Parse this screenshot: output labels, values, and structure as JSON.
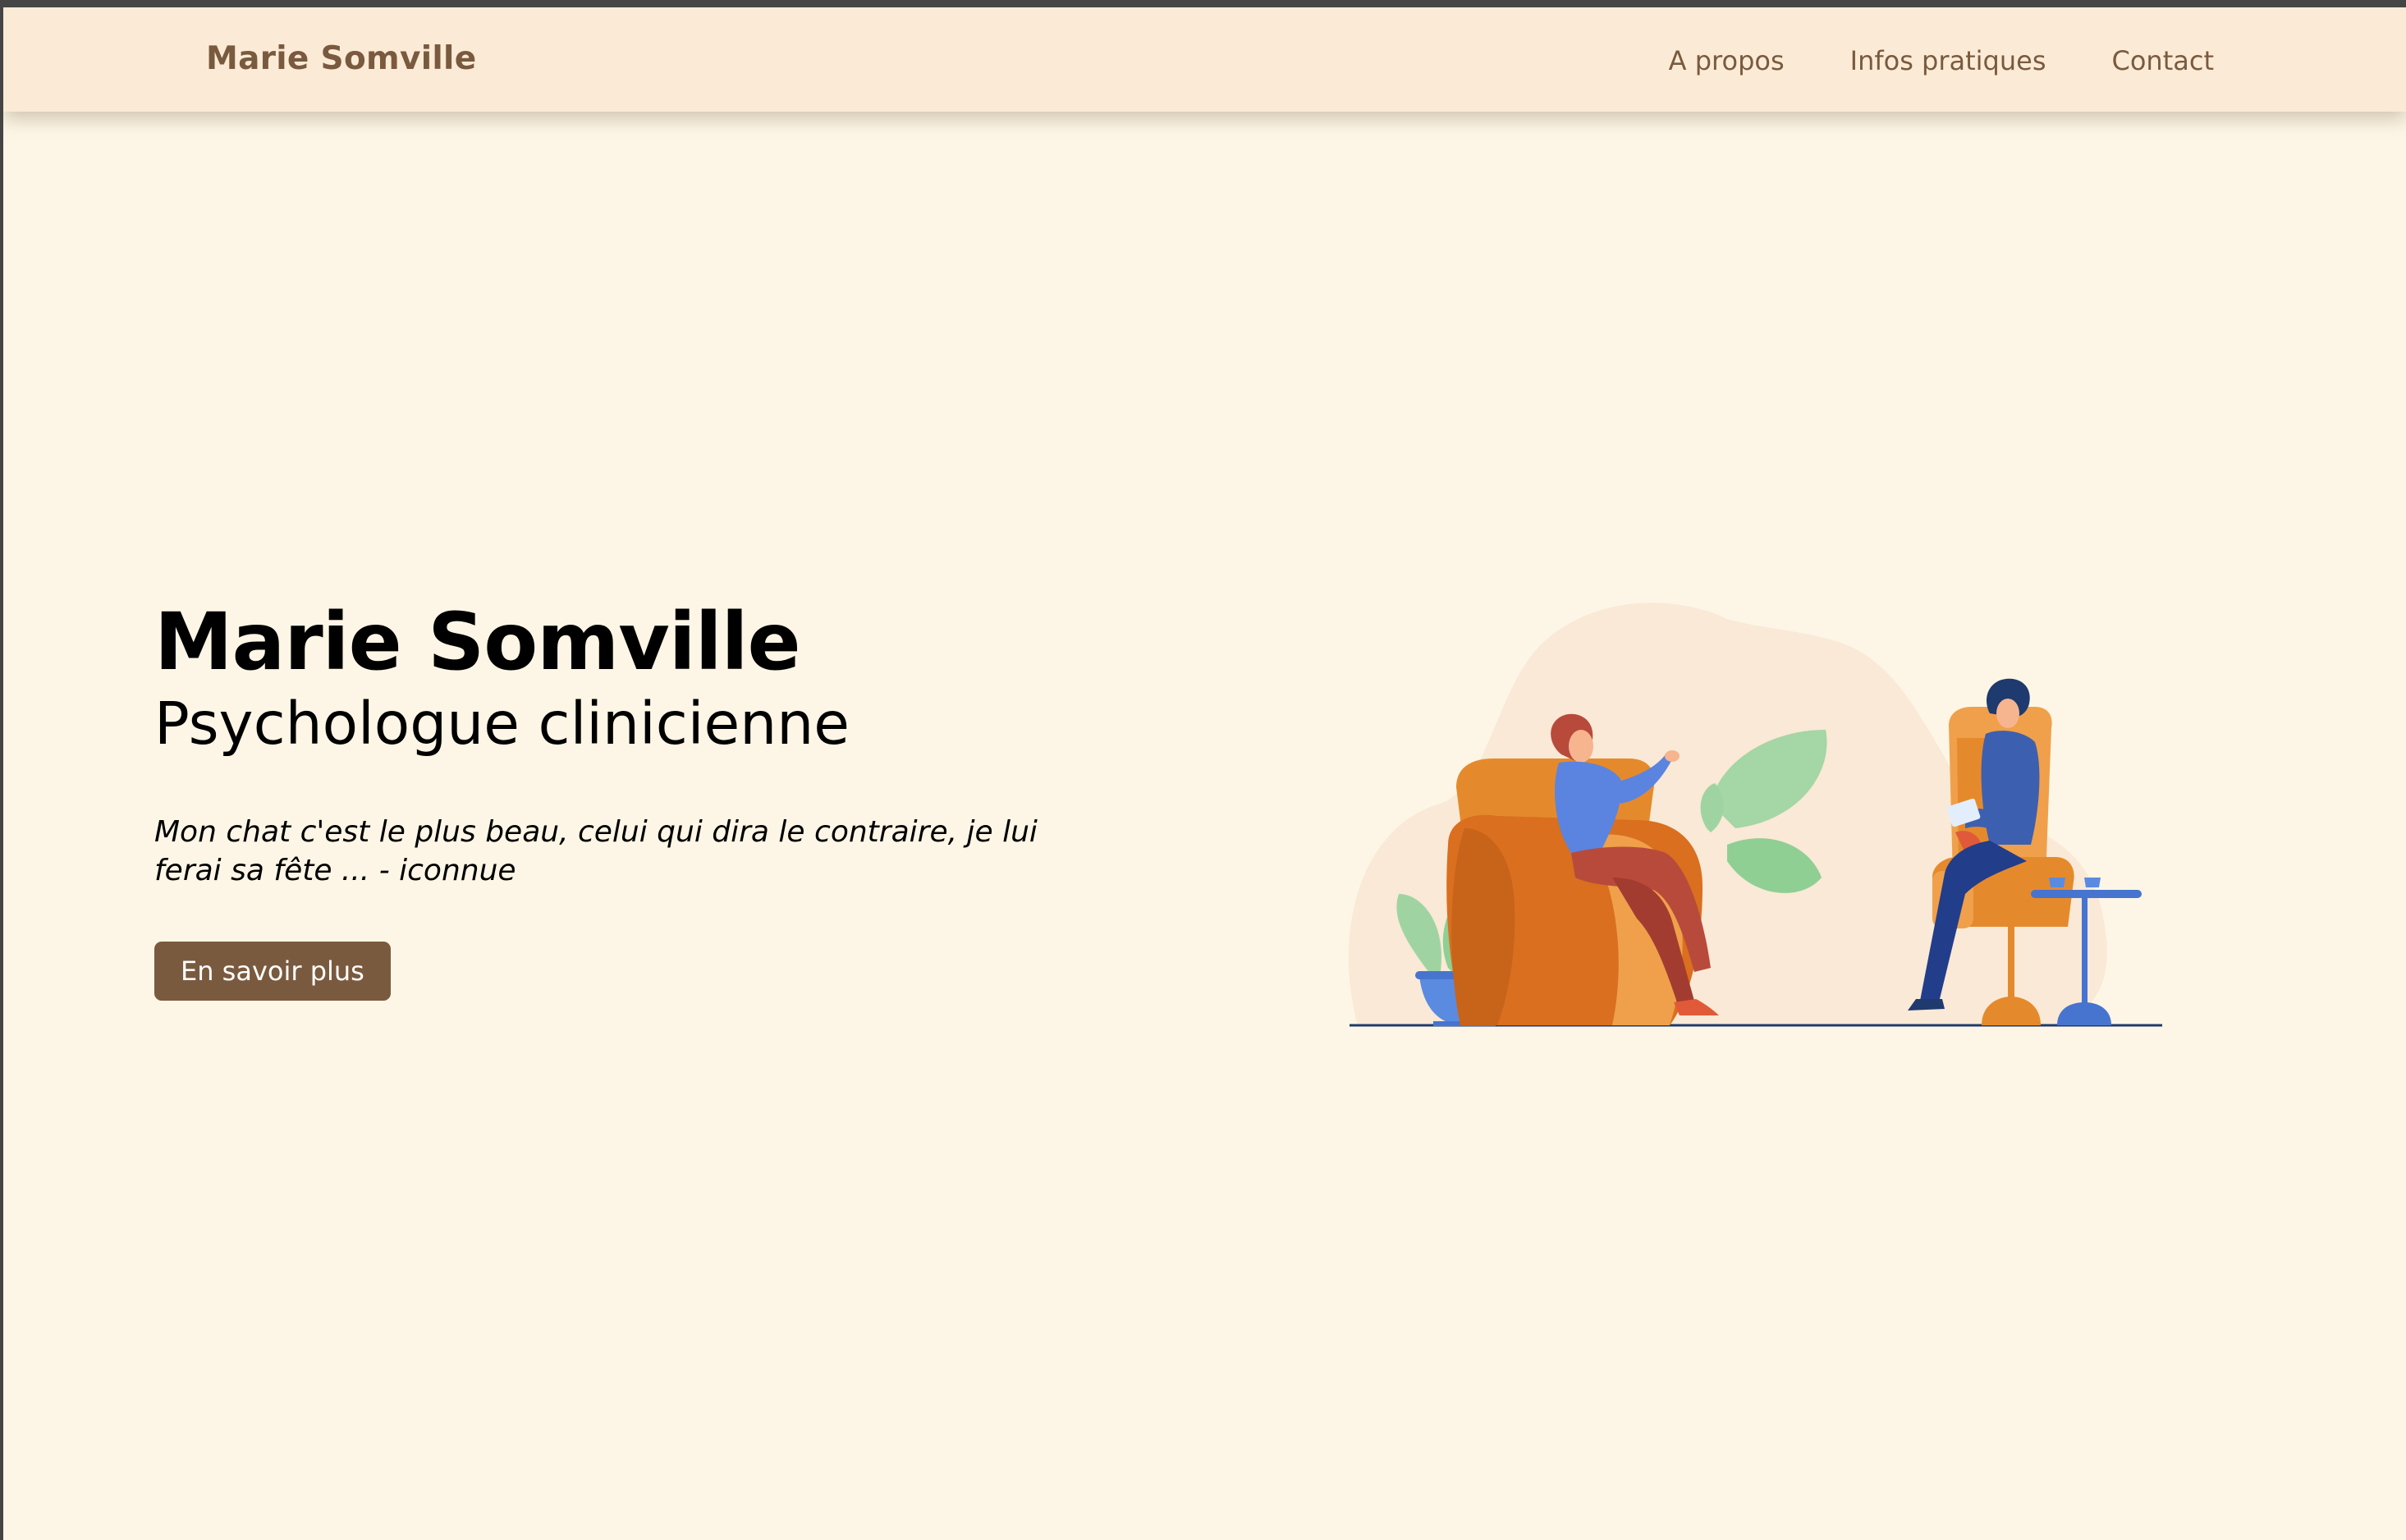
{
  "nav": {
    "brand": "Marie Somville",
    "links": [
      {
        "label": "A propos"
      },
      {
        "label": "Infos pratiques"
      },
      {
        "label": "Contact"
      }
    ]
  },
  "hero": {
    "title": "Marie Somville",
    "subtitle": "Psychologue clinicienne",
    "quote": "Mon chat c'est le plus beau, celui qui dira le contraire, je lui ferai sa fête ... - iconnue",
    "button_label": "En savoir plus"
  },
  "colors": {
    "page_background": "#fdf6e6",
    "navbar_background": "#fbebd6",
    "brand_text": "#7a5a3f",
    "button_background": "#7a5a3f",
    "button_text": "#ffffff"
  },
  "illustration": {
    "icon": "therapy-session-illustration"
  }
}
